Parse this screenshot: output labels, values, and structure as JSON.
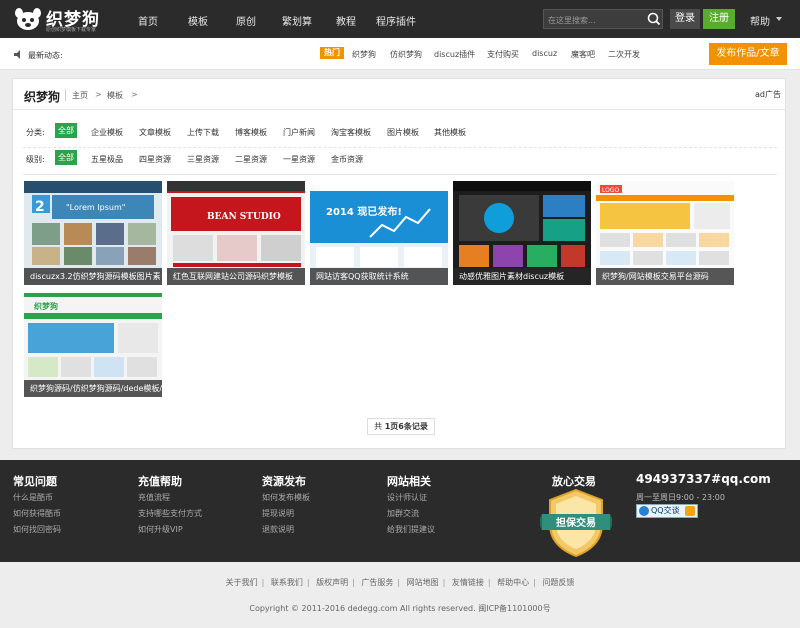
{
  "header": {
    "logo_text": "织梦狗",
    "logo_sub": "原创织梦模板下载专家",
    "nav": [
      "首页",
      "模板",
      "原创",
      "繁划算",
      "教程",
      "程序插件"
    ],
    "search_placeholder": "在这里搜索...",
    "login": "登录",
    "register": "注册",
    "help": "帮助"
  },
  "notice": {
    "label": "最新动态:",
    "hot_tag": "热门",
    "hot_links": [
      "织梦狗",
      "仿织梦狗",
      "discuz插件",
      "支付购买",
      "discuz",
      "魔客吧",
      "二次开发"
    ],
    "publish": "发布作品/文章"
  },
  "breadcrumb": {
    "title": "织梦狗",
    "home": "主页",
    "arrow1": ">",
    "current": "模板",
    "arrow2": ">",
    "ad": "ad广告"
  },
  "filters": {
    "category_label": "分类:",
    "category_all": "全部",
    "categories": [
      "企业模板",
      "文章模板",
      "上传下载",
      "博客模板",
      "门户新闻",
      "淘宝客模板",
      "图片模板",
      "其他模板"
    ],
    "level_label": "级别:",
    "level_all": "全部",
    "levels": [
      "五星极品",
      "四星资源",
      "三星资源",
      "二星资源",
      "一星资源",
      "金币资源"
    ]
  },
  "cards": [
    {
      "caption": "discuzx3.2仿织梦狗源码模板图片素",
      "thumb_text": "\"Lorem Ipsum\""
    },
    {
      "caption": "红色互联网建站公司源码织梦模板",
      "thumb_text": "BEAN STUDIO"
    },
    {
      "caption": "网站访客QQ获取统计系统",
      "thumb_text": "2014 现已发布!"
    },
    {
      "caption": "动感优雅图片素材discuz模板",
      "thumb_text": ""
    },
    {
      "caption": "织梦狗/网站模板交易平台源码",
      "thumb_text": "LOGO"
    },
    {
      "caption": "织梦狗源码/仿织梦狗源码/dede模板/",
      "thumb_text": "织梦狗"
    }
  ],
  "pager": {
    "prefix": "共",
    "pages": "1页",
    "records": "6条记录"
  },
  "footer": {
    "cols": [
      {
        "title": "常见问题",
        "links": [
          "什么是酷币",
          "如何获得酷币",
          "如何找回密码"
        ]
      },
      {
        "title": "充值帮助",
        "links": [
          "充值流程",
          "支持哪些支付方式",
          "如何升级VIP"
        ]
      },
      {
        "title": "资源发布",
        "links": [
          "如何发布模板",
          "提现说明",
          "退款说明"
        ]
      },
      {
        "title": "网站相关",
        "links": [
          "设计师认证",
          "加群交流",
          "给我们提建议"
        ]
      }
    ],
    "trade_title": "放心交易",
    "badge_text": "担保交易",
    "email": "494937337#qq.com",
    "hours": "周一至周日9:00 - 23:00",
    "qq": "QQ交谈"
  },
  "bottom": {
    "links": [
      "关于我们",
      "联系我们",
      "版权声明",
      "广告服务",
      "网站地图",
      "友情链接",
      "帮助中心",
      "问题反馈"
    ],
    "copyright": "Copyright © 2011-2016 dedegg.com All rights reserved. 闽ICP备1101000号"
  }
}
